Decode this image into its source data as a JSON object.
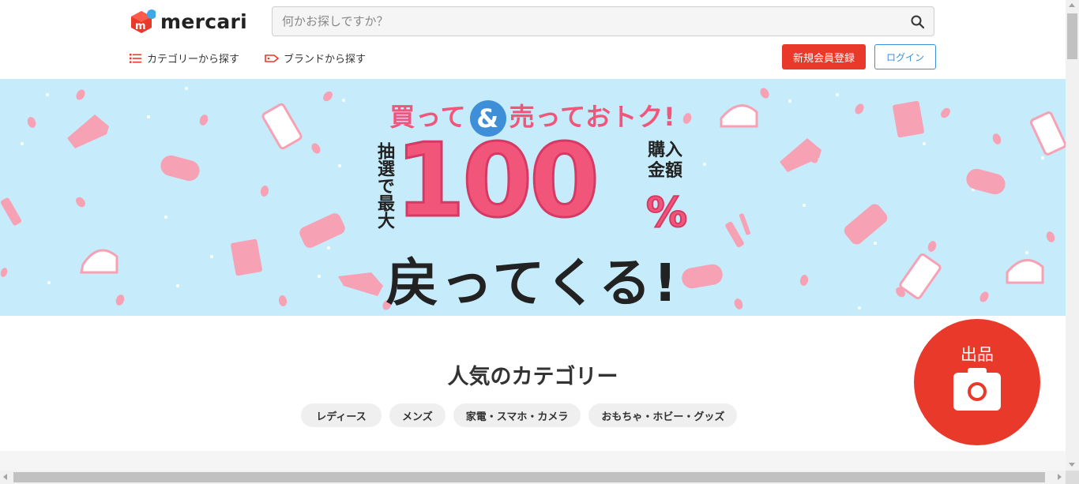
{
  "header": {
    "logo_text": "mercari",
    "search": {
      "placeholder": "何かお探しですか？",
      "value": ""
    },
    "nav": {
      "categories": "カテゴリーから探す",
      "brands": "ブランドから探す"
    },
    "signup_label": "新規会員登録",
    "login_label": "ログイン"
  },
  "banner": {
    "line1_a": "買って",
    "line1_amp": "&",
    "line1_b": "売っておトク!",
    "left_text": "抽選で最大",
    "big_number": "100",
    "right_text": "購入金額",
    "percent": "%",
    "line3": "戻ってくる!"
  },
  "categories": {
    "title": "人気のカテゴリー",
    "chips": [
      "レディース",
      "メンズ",
      "家電・スマホ・カメラ",
      "おもちゃ・ホビー・グッズ"
    ]
  },
  "sell_button": {
    "label": "出品",
    "icon": "camera-icon"
  },
  "colors": {
    "brand_red": "#e9392b",
    "login_blue": "#3a8fd6",
    "banner_bg": "#c6ecfb",
    "banner_pink": "#f2557a"
  }
}
